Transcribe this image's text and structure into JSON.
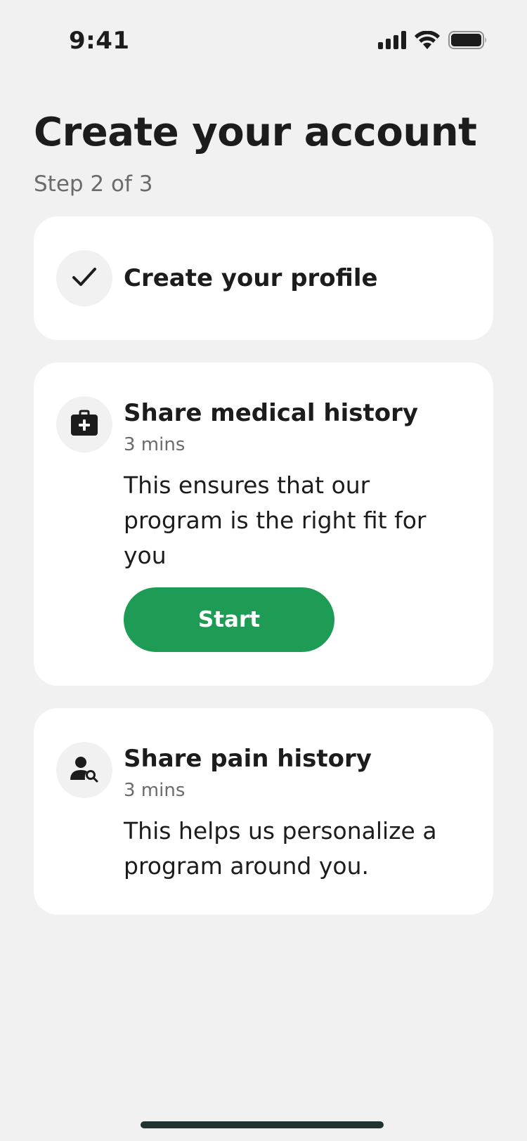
{
  "status_bar": {
    "time": "9:41",
    "icons": [
      "cellular-signal-icon",
      "wifi-icon",
      "battery-icon"
    ]
  },
  "header": {
    "title": "Create your account",
    "step": "Step 2 of 3"
  },
  "steps": [
    {
      "title": "Create your profile",
      "icon": "checkmark-icon",
      "completed": true
    },
    {
      "title": "Share medical history",
      "duration": "3 mins",
      "description": "This ensures that our program is the right fit for you",
      "icon": "medical-kit-icon",
      "button_label": "Start"
    },
    {
      "title": "Share pain history",
      "duration": "3 mins",
      "description": "This helps us personalize a program around you.",
      "icon": "user-search-icon"
    }
  ],
  "colors": {
    "background": "#f1f1f1",
    "card": "#ffffff",
    "accent": "#1e9c56",
    "text": "#1c1c1c",
    "muted": "#6b6b6b"
  }
}
